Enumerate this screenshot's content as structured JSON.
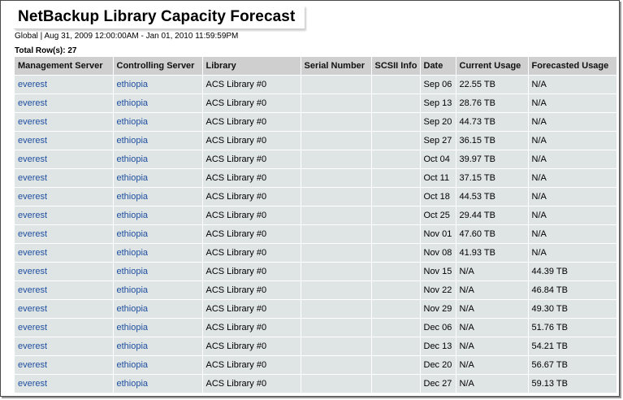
{
  "report": {
    "title": "NetBackup Library Capacity Forecast",
    "subtitle": "Global | Aug 31, 2009 12:00:00AM - Jan 01, 2010 11:59:59PM",
    "row_count": "Total Row(s): 27"
  },
  "table": {
    "headers": [
      "Management Server",
      "Controlling Server",
      "Library",
      "Serial Number",
      "SCSII Info",
      "Date",
      "Current Usage",
      "Forecasted Usage"
    ],
    "rows": [
      [
        "everest",
        "ethiopia",
        "ACS Library #0",
        "",
        "",
        "Sep 06",
        "22.55 TB",
        "N/A"
      ],
      [
        "everest",
        "ethiopia",
        "ACS Library #0",
        "",
        "",
        "Sep 13",
        "28.76 TB",
        "N/A"
      ],
      [
        "everest",
        "ethiopia",
        "ACS Library #0",
        "",
        "",
        "Sep 20",
        "44.73 TB",
        "N/A"
      ],
      [
        "everest",
        "ethiopia",
        "ACS Library #0",
        "",
        "",
        "Sep 27",
        "36.15 TB",
        "N/A"
      ],
      [
        "everest",
        "ethiopia",
        "ACS Library #0",
        "",
        "",
        "Oct 04",
        "39.97 TB",
        "N/A"
      ],
      [
        "everest",
        "ethiopia",
        "ACS Library #0",
        "",
        "",
        "Oct 11",
        "37.15 TB",
        "N/A"
      ],
      [
        "everest",
        "ethiopia",
        "ACS Library #0",
        "",
        "",
        "Oct 18",
        "44.53 TB",
        "N/A"
      ],
      [
        "everest",
        "ethiopia",
        "ACS Library #0",
        "",
        "",
        "Oct 25",
        "29.44 TB",
        "N/A"
      ],
      [
        "everest",
        "ethiopia",
        "ACS Library #0",
        "",
        "",
        "Nov 01",
        "47.60 TB",
        "N/A"
      ],
      [
        "everest",
        "ethiopia",
        "ACS Library #0",
        "",
        "",
        "Nov 08",
        "41.93 TB",
        "N/A"
      ],
      [
        "everest",
        "ethiopia",
        "ACS Library #0",
        "",
        "",
        "Nov 15",
        "N/A",
        "44.39 TB"
      ],
      [
        "everest",
        "ethiopia",
        "ACS Library #0",
        "",
        "",
        "Nov 22",
        "N/A",
        "46.84 TB"
      ],
      [
        "everest",
        "ethiopia",
        "ACS Library #0",
        "",
        "",
        "Nov 29",
        "N/A",
        "49.30 TB"
      ],
      [
        "everest",
        "ethiopia",
        "ACS Library #0",
        "",
        "",
        "Dec 06",
        "N/A",
        "51.76 TB"
      ],
      [
        "everest",
        "ethiopia",
        "ACS Library #0",
        "",
        "",
        "Dec 13",
        "N/A",
        "54.21 TB"
      ],
      [
        "everest",
        "ethiopia",
        "ACS Library #0",
        "",
        "",
        "Dec 20",
        "N/A",
        "56.67 TB"
      ],
      [
        "everest",
        "ethiopia",
        "ACS Library #0",
        "",
        "",
        "Dec 27",
        "N/A",
        "59.13 TB"
      ]
    ]
  },
  "colors": {
    "link": "#1f4fa0",
    "header_bg": "#cfcfcf",
    "cell_bg": "#dfe4e4"
  }
}
